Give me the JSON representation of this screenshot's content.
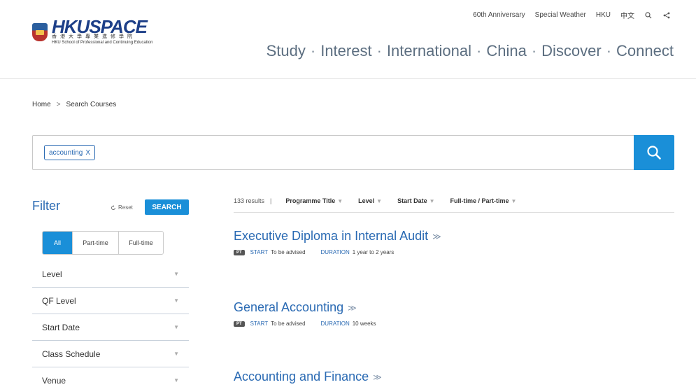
{
  "logo": {
    "word_hku": "HKU",
    "word_space": "SPACE",
    "chinese": "香港大學專業進修學院",
    "subtitle": "HKU School of Professional and Continuing Education"
  },
  "topbar": {
    "items": [
      "60th Anniversary",
      "Special Weather",
      "HKU",
      "中文"
    ]
  },
  "mainnav": {
    "items": [
      "Study",
      "Interest",
      "International",
      "China",
      "Discover",
      "Connect"
    ],
    "separator": "·"
  },
  "breadcrumb": {
    "home": "Home",
    "arrow": ">",
    "current": "Search Courses"
  },
  "search": {
    "tag": "accounting",
    "tag_remove": "X"
  },
  "filter": {
    "title": "Filter",
    "reset": "Reset",
    "search_button": "SEARCH",
    "modes": [
      "All",
      "Part-time",
      "Full-time"
    ],
    "items": [
      "Level",
      "QF Level",
      "Start Date",
      "Class Schedule",
      "Venue"
    ]
  },
  "results": {
    "count": "133 results",
    "divider": "|",
    "sort_options": [
      "Programme Title",
      "Level",
      "Start Date",
      "Full-time / Part-time"
    ]
  },
  "courses": [
    {
      "title": "Executive Diploma in Internal Audit",
      "badge": "PT",
      "start_label": "START",
      "start": "To be advised",
      "duration_label": "DURATION",
      "duration": "1 year to 2 years"
    },
    {
      "title": "General Accounting",
      "badge": "PT",
      "start_label": "START",
      "start": "To be advised",
      "duration_label": "DURATION",
      "duration": "10 weeks"
    },
    {
      "title": "Accounting and Finance"
    }
  ],
  "colors": {
    "accent": "#1a8fd8",
    "link": "#2a6ab3",
    "nav": "#5c6e80"
  }
}
